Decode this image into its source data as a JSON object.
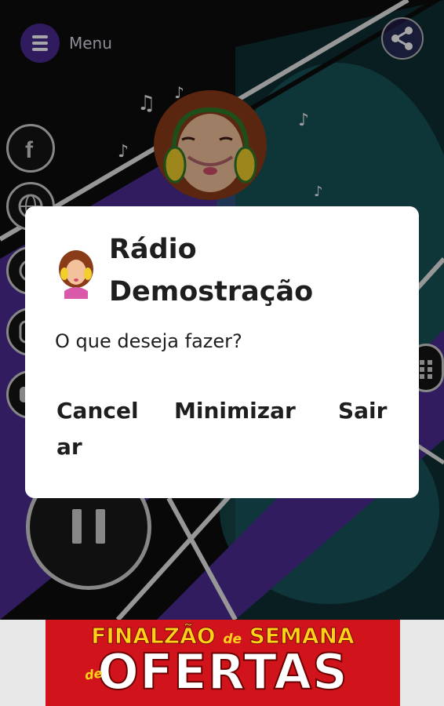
{
  "header": {
    "menu_label": "Menu"
  },
  "dialog": {
    "title": "Rádio Demostração",
    "message": "O que deseja fazer?",
    "cancel_label": "Cancelar",
    "minimize_label": "Minimizar",
    "exit_label": "Sair"
  },
  "ad": {
    "line1_a": "FINALZÃO",
    "line1_de": "de",
    "line1_b": "SEMANA",
    "line2_de": "de",
    "line2": "OFERTAS"
  },
  "colors": {
    "purple": "#4b2a92",
    "teal": "#2aa9a9",
    "ad_red": "#d1141b",
    "ad_yellow": "#ffd21a"
  },
  "icons": [
    "menu-icon",
    "share-icon",
    "facebook-icon",
    "globe-icon",
    "whatsapp-icon",
    "instagram-icon",
    "youtube-icon",
    "keypad-icon",
    "pause-icon"
  ]
}
